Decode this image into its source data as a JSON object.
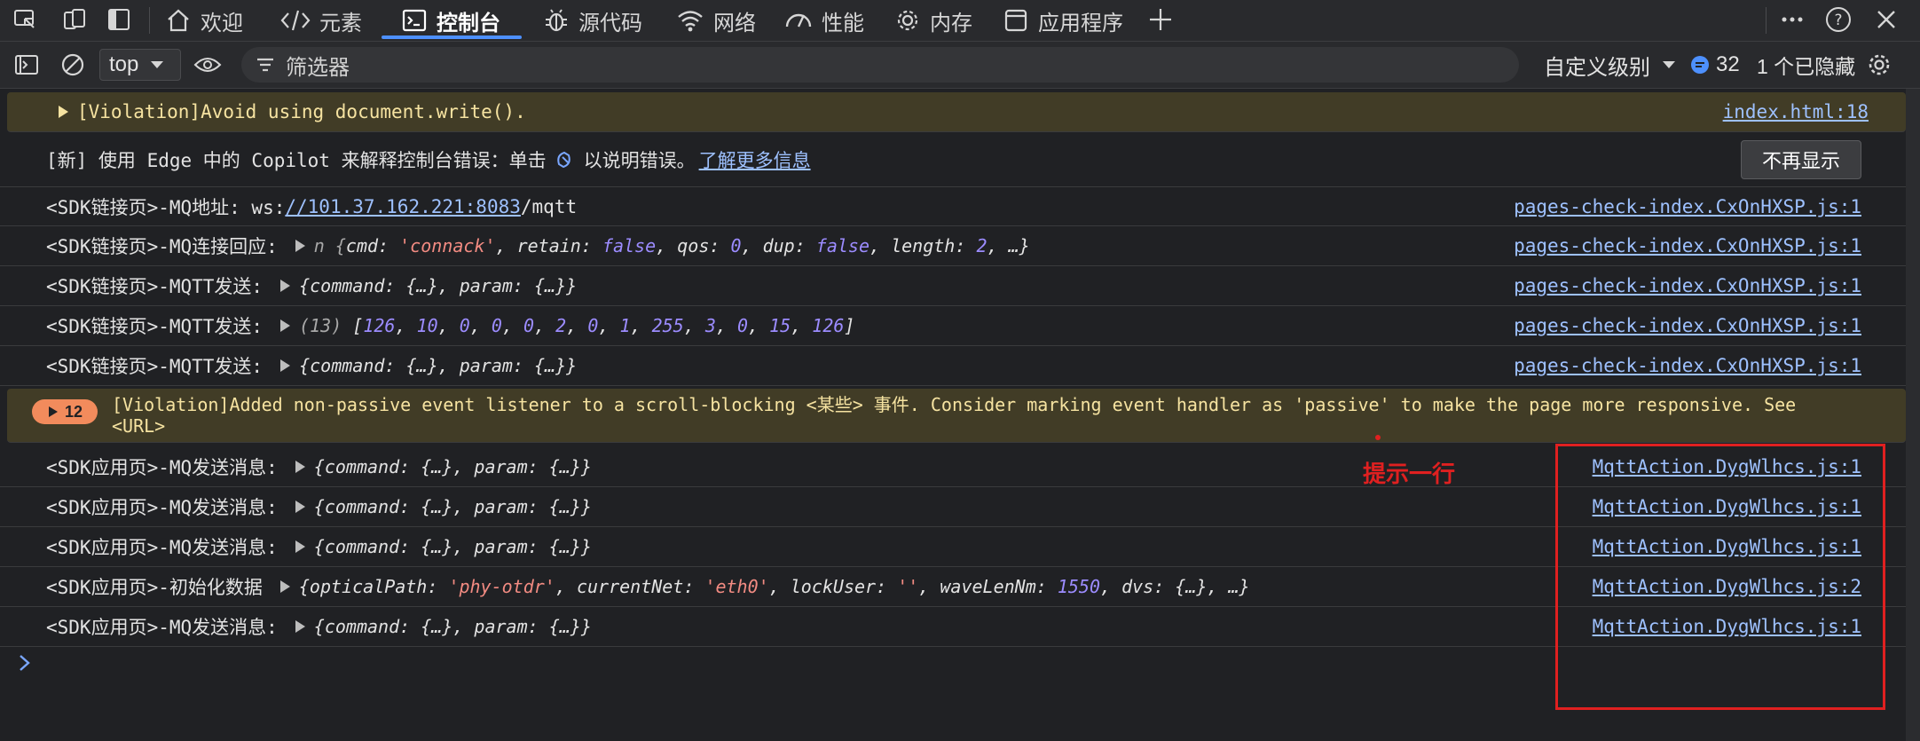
{
  "tabbar": {
    "tabs": [
      {
        "label": "欢迎",
        "icon": "home-icon"
      },
      {
        "label": "元素",
        "icon": "code-icon"
      },
      {
        "label": "控制台",
        "icon": "console-icon"
      },
      {
        "label": "源代码",
        "icon": "bug-icon"
      },
      {
        "label": "网络",
        "icon": "wifi-icon"
      },
      {
        "label": "性能",
        "icon": "performance-icon"
      },
      {
        "label": "内存",
        "icon": "gear-icon"
      },
      {
        "label": "应用程序",
        "icon": "app-icon"
      }
    ],
    "active_tab": "控制台"
  },
  "filterbar": {
    "context": "top",
    "filter_placeholder": "筛选器",
    "level": "自定义级别",
    "message_count": "32",
    "hidden_text": "1 个已隐藏"
  },
  "messages": {
    "violation_doc_write": {
      "text": "[Violation]Avoid using document.write().",
      "source": "index.html:18"
    },
    "copilot": {
      "prefix": "[新] 使用 Edge 中的 Copilot 来解释控制台错误：单击",
      "suffix": "以说明错误。",
      "link": "了解更多信息",
      "button": "不再显示"
    },
    "mq_address": {
      "label": "<SDK链接页>-MQ地址: ws:",
      "link": "//101.37.162.221:8083",
      "tail": "/mqtt",
      "source": "pages-check-index.CxOnHXSP.js:1"
    },
    "mq_connack": {
      "label": "<SDK链接页>-MQ连接回应:",
      "obj_prefix": "n {",
      "k1": "cmd: ",
      "v1": "'connack'",
      "k2": ", retain: ",
      "v2": "false",
      "k3": ", qos: ",
      "v3": "0",
      "k4": ", dup: ",
      "v4": "false",
      "k5": ", length: ",
      "v5": "2",
      "obj_suffix": ", …}",
      "source": "pages-check-index.CxOnHXSP.js:1"
    },
    "mqtt_send_1": {
      "label": "<SDK链接页>-MQTT发送:",
      "obj": "{command: {…}, param: {…}}",
      "source": "pages-check-index.CxOnHXSP.js:1"
    },
    "mqtt_send_2": {
      "label": "<SDK链接页>-MQTT发送:",
      "count": "(13) ",
      "array": [
        "126",
        "10",
        "0",
        "0",
        "0",
        "2",
        "0",
        "1",
        "255",
        "3",
        "0",
        "15",
        "126"
      ],
      "source": "pages-check-index.CxOnHXSP.js:1"
    },
    "mqtt_send_3": {
      "label": "<SDK链接页>-MQTT发送:",
      "obj": "{command: {…}, param: {…}}",
      "source": "pages-check-index.CxOnHXSP.js:1"
    },
    "violation_listener": {
      "badge": "12",
      "line1": "[Violation]Added non-passive event listener to a scroll-blocking <某些> 事件. Consider marking event handler as 'passive' to make the page more responsive. See",
      "line2": "<URL>"
    },
    "app_send_1": {
      "label": "<SDK应用页>-MQ发送消息:",
      "obj": "{command: {…}, param: {…}}",
      "source": "MqttAction.DygWlhcs.js:1"
    },
    "app_send_2": {
      "label": "<SDK应用页>-MQ发送消息:",
      "obj": "{command: {…}, param: {…}}",
      "source": "MqttAction.DygWlhcs.js:1"
    },
    "app_send_3": {
      "label": "<SDK应用页>-MQ发送消息:",
      "obj": "{command: {…}, param: {…}}",
      "source": "MqttAction.DygWlhcs.js:1"
    },
    "app_init": {
      "label": "<SDK应用页>-初始化数据",
      "k1": "{opticalPath: ",
      "v1": "'phy-otdr'",
      "k2": ", currentNet: ",
      "v2": "'eth0'",
      "k3": ", lockUser: ",
      "v3": "''",
      "k4": ", waveLenNm: ",
      "v4": "1550",
      "k5": ", dvs: {…}, …}",
      "source": "MqttAction.DygWlhcs.js:2"
    },
    "app_send_4": {
      "label": "<SDK应用页>-MQ发送消息:",
      "obj": "{command: {…}, param: {…}}",
      "source": "MqttAction.DygWlhcs.js:1"
    }
  },
  "annotation": {
    "text": "提示一行",
    "color": "#e02020"
  },
  "colors": {
    "accent": "#4d90fe",
    "link": "#9ec1ff",
    "warning_bg": "#413c26",
    "string": "#f28b82",
    "number": "#9c8cff"
  }
}
